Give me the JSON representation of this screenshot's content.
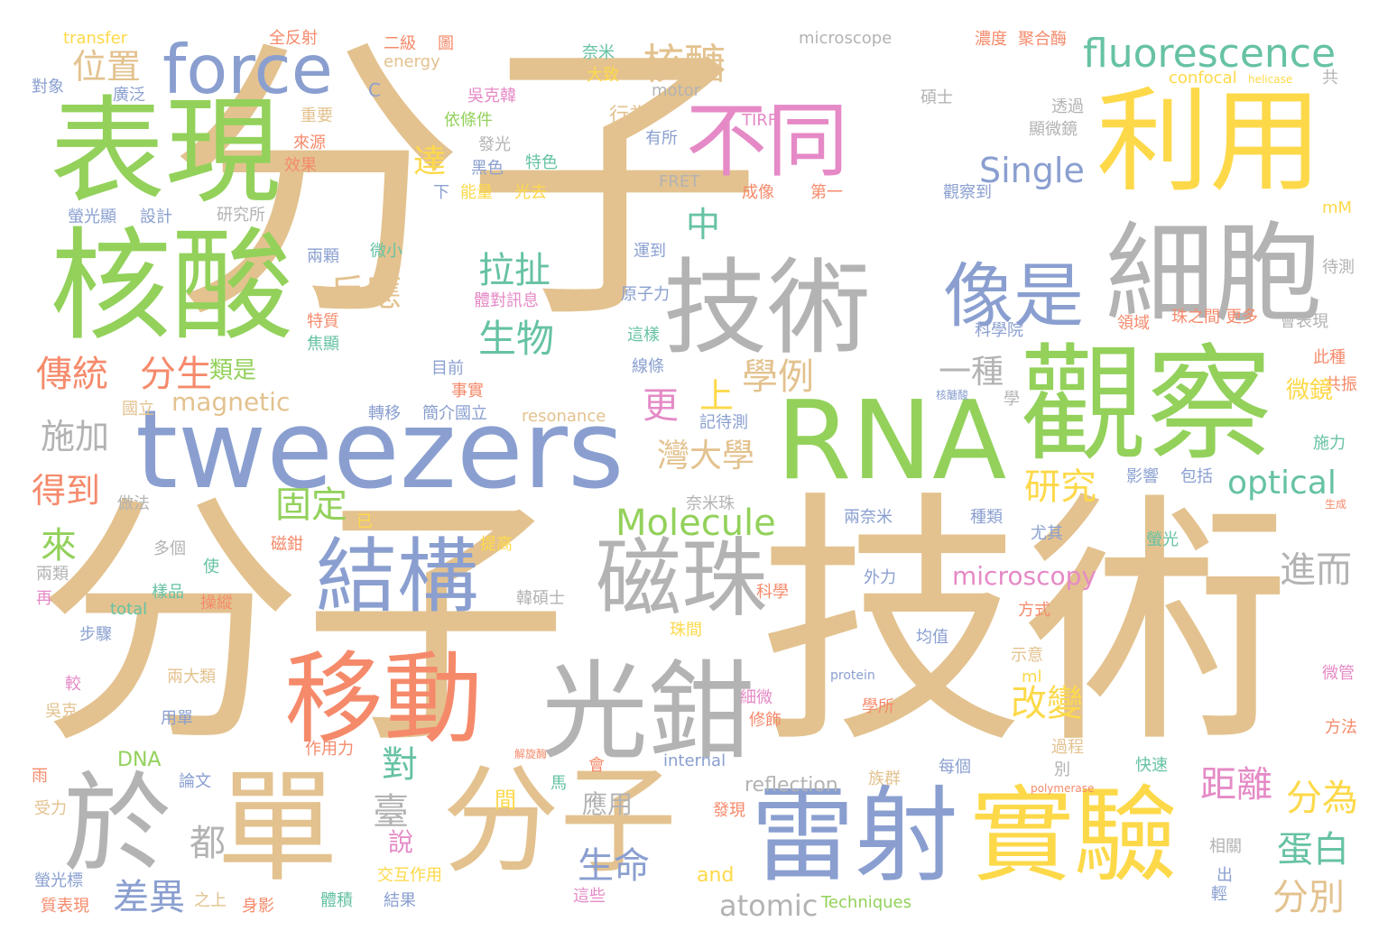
{
  "palette": {
    "tan": "#e3c28f",
    "green": "#93d15b",
    "blue": "#8a9fd0",
    "gray": "#b3b3b3",
    "yellow": "#fdd94a",
    "pink": "#e58ac6",
    "orange": "#f58a6b",
    "teal": "#66c2a4"
  },
  "words": [
    {
      "text": "分子",
      "color": "tan"
    },
    {
      "text": "分子",
      "color": "tan"
    },
    {
      "text": "技術",
      "color": "tan"
    },
    {
      "text": "tweezers",
      "color": "blue"
    },
    {
      "text": "觀察",
      "color": "green"
    },
    {
      "text": "RNA",
      "color": "green"
    },
    {
      "text": "技術",
      "color": "gray"
    },
    {
      "text": "表現",
      "color": "green"
    },
    {
      "text": "核酸",
      "color": "green"
    },
    {
      "text": "利用",
      "color": "yellow"
    },
    {
      "text": "細胞",
      "color": "gray"
    },
    {
      "text": "force",
      "color": "blue"
    },
    {
      "text": "不同",
      "color": "pink"
    },
    {
      "text": "fluorescence",
      "color": "teal"
    },
    {
      "text": "像是",
      "color": "blue"
    },
    {
      "text": "單",
      "color": "tan"
    },
    {
      "text": "分子",
      "color": "tan"
    },
    {
      "text": "雷射",
      "color": "blue"
    },
    {
      "text": "實驗",
      "color": "yellow"
    },
    {
      "text": "於",
      "color": "gray"
    },
    {
      "text": "光鉗",
      "color": "gray"
    },
    {
      "text": "移動",
      "color": "orange"
    },
    {
      "text": "結構",
      "color": "blue"
    },
    {
      "text": "磁珠",
      "color": "gray"
    },
    {
      "text": "核醣",
      "color": "tan"
    },
    {
      "text": "位置",
      "color": "tan"
    },
    {
      "text": "Single",
      "color": "blue"
    },
    {
      "text": "Molecule",
      "color": "green"
    },
    {
      "text": "optical",
      "color": "teal"
    },
    {
      "text": "拉扯",
      "color": "teal"
    },
    {
      "text": "反應",
      "color": "tan"
    },
    {
      "text": "生物",
      "color": "teal"
    },
    {
      "text": "傳統",
      "color": "orange"
    },
    {
      "text": "分生",
      "color": "orange"
    },
    {
      "text": "施加",
      "color": "gray"
    },
    {
      "text": "得到",
      "color": "orange"
    },
    {
      "text": "固定",
      "color": "green"
    },
    {
      "text": "magnetic",
      "color": "tan"
    },
    {
      "text": "一種",
      "color": "gray"
    },
    {
      "text": "學例",
      "color": "tan"
    },
    {
      "text": "灣大學",
      "color": "tan"
    },
    {
      "text": "研究",
      "color": "yellow"
    },
    {
      "text": "進而",
      "color": "gray"
    },
    {
      "text": "改變",
      "color": "yellow"
    },
    {
      "text": "距離",
      "color": "pink"
    },
    {
      "text": "分為",
      "color": "yellow"
    },
    {
      "text": "蛋白",
      "color": "teal"
    },
    {
      "text": "生命",
      "color": "blue"
    },
    {
      "text": "差異",
      "color": "blue"
    },
    {
      "text": "分別",
      "color": "tan"
    },
    {
      "text": "atomic",
      "color": "gray"
    },
    {
      "text": "microscopy",
      "color": "pink"
    },
    {
      "text": "來",
      "color": "green"
    },
    {
      "text": "都",
      "color": "gray"
    },
    {
      "text": "對",
      "color": "teal"
    },
    {
      "text": "臺",
      "color": "gray"
    },
    {
      "text": "說",
      "color": "pink"
    },
    {
      "text": "中",
      "color": "teal"
    },
    {
      "text": "更",
      "color": "pink"
    },
    {
      "text": "上",
      "color": "yellow"
    },
    {
      "text": "達",
      "color": "yellow"
    },
    {
      "text": "應用",
      "color": "gray"
    },
    {
      "text": "microscope",
      "color": "gray"
    },
    {
      "text": "transfer",
      "color": "yellow"
    },
    {
      "text": "全反射",
      "color": "orange"
    },
    {
      "text": "二級",
      "color": "orange"
    },
    {
      "text": "圖",
      "color": "orange"
    },
    {
      "text": "energy",
      "color": "tan"
    },
    {
      "text": "奈米",
      "color": "teal"
    },
    {
      "text": "大致",
      "color": "yellow"
    },
    {
      "text": "濃度",
      "color": "orange"
    },
    {
      "text": "聚合酶",
      "color": "orange"
    },
    {
      "text": "confocal",
      "color": "yellow"
    },
    {
      "text": "helicase",
      "color": "yellow"
    },
    {
      "text": "共",
      "color": "gray"
    },
    {
      "text": "對象",
      "color": "blue"
    },
    {
      "text": "廣泛",
      "color": "blue"
    },
    {
      "text": "C",
      "color": "blue"
    },
    {
      "text": "吳克韓",
      "color": "pink"
    },
    {
      "text": "motor",
      "color": "gray"
    },
    {
      "text": "碩士",
      "color": "gray"
    },
    {
      "text": "透過",
      "color": "gray"
    },
    {
      "text": "重要",
      "color": "tan"
    },
    {
      "text": "行為",
      "color": "tan"
    },
    {
      "text": "依條件",
      "color": "green"
    },
    {
      "text": "TIRF",
      "color": "pink"
    },
    {
      "text": "顯微鏡",
      "color": "gray"
    },
    {
      "text": "來源",
      "color": "orange"
    },
    {
      "text": "有所",
      "color": "blue"
    },
    {
      "text": "發光",
      "color": "gray"
    },
    {
      "text": "效果",
      "color": "orange"
    },
    {
      "text": "黑色",
      "color": "blue"
    },
    {
      "text": "特色",
      "color": "teal"
    },
    {
      "text": "FRET",
      "color": "gray"
    },
    {
      "text": "能量",
      "color": "yellow"
    },
    {
      "text": "光去",
      "color": "yellow"
    },
    {
      "text": "下",
      "color": "blue"
    },
    {
      "text": "成像",
      "color": "orange"
    },
    {
      "text": "第一",
      "color": "orange"
    },
    {
      "text": "觀察到",
      "color": "blue"
    },
    {
      "text": "螢光顯",
      "color": "blue"
    },
    {
      "text": "設計",
      "color": "blue"
    },
    {
      "text": "研究所",
      "color": "gray"
    },
    {
      "text": "mM",
      "color": "yellow"
    },
    {
      "text": "運到",
      "color": "blue"
    },
    {
      "text": "待測",
      "color": "gray"
    },
    {
      "text": "兩顆",
      "color": "blue"
    },
    {
      "text": "微小",
      "color": "teal"
    },
    {
      "text": "原子力",
      "color": "blue"
    },
    {
      "text": "體對訊息",
      "color": "pink"
    },
    {
      "text": "特質",
      "color": "orange"
    },
    {
      "text": "領域",
      "color": "orange"
    },
    {
      "text": "珠之間",
      "color": "orange"
    },
    {
      "text": "更多",
      "color": "orange"
    },
    {
      "text": "會表現",
      "color": "gray"
    },
    {
      "text": "焦顯",
      "color": "teal"
    },
    {
      "text": "這樣",
      "color": "teal"
    },
    {
      "text": "科學院",
      "color": "blue"
    },
    {
      "text": "類是",
      "color": "green"
    },
    {
      "text": "目前",
      "color": "blue"
    },
    {
      "text": "線條",
      "color": "blue"
    },
    {
      "text": "此種",
      "color": "orange"
    },
    {
      "text": "國立",
      "color": "tan"
    },
    {
      "text": "事實",
      "color": "orange"
    },
    {
      "text": "核醣酸",
      "color": "blue"
    },
    {
      "text": "學",
      "color": "gray"
    },
    {
      "text": "轉移",
      "color": "blue"
    },
    {
      "text": "簡介國立",
      "color": "blue"
    },
    {
      "text": "resonance",
      "color": "tan"
    },
    {
      "text": "記待測",
      "color": "blue"
    },
    {
      "text": "共振",
      "color": "orange"
    },
    {
      "text": "微鏡",
      "color": "yellow"
    },
    {
      "text": "施力",
      "color": "teal"
    },
    {
      "text": "影響",
      "color": "blue"
    },
    {
      "text": "包括",
      "color": "blue"
    },
    {
      "text": "做法",
      "color": "gray"
    },
    {
      "text": "已",
      "color": "yellow"
    },
    {
      "text": "奈米珠",
      "color": "gray"
    },
    {
      "text": "兩奈米",
      "color": "blue"
    },
    {
      "text": "種類",
      "color": "blue"
    },
    {
      "text": "生成",
      "color": "orange"
    },
    {
      "text": "多個",
      "color": "gray"
    },
    {
      "text": "磁鉗",
      "color": "orange"
    },
    {
      "text": "提高",
      "color": "yellow"
    },
    {
      "text": "尤其",
      "color": "blue"
    },
    {
      "text": "螢光",
      "color": "teal"
    },
    {
      "text": "兩類",
      "color": "gray"
    },
    {
      "text": "使",
      "color": "teal"
    },
    {
      "text": "外力",
      "color": "blue"
    },
    {
      "text": "樣品",
      "color": "teal"
    },
    {
      "text": "再",
      "color": "pink"
    },
    {
      "text": "操縱",
      "color": "orange"
    },
    {
      "text": "韓碩士",
      "color": "gray"
    },
    {
      "text": "科學",
      "color": "orange"
    },
    {
      "text": "total",
      "color": "teal"
    },
    {
      "text": "方式",
      "color": "orange"
    },
    {
      "text": "珠間",
      "color": "yellow"
    },
    {
      "text": "均值",
      "color": "blue"
    },
    {
      "text": "步驟",
      "color": "blue"
    },
    {
      "text": "示意",
      "color": "tan"
    },
    {
      "text": "兩大類",
      "color": "tan"
    },
    {
      "text": "protein",
      "color": "blue"
    },
    {
      "text": "ml",
      "color": "yellow"
    },
    {
      "text": "微管",
      "color": "pink"
    },
    {
      "text": "較",
      "color": "pink"
    },
    {
      "text": "細微",
      "color": "pink"
    },
    {
      "text": "學所",
      "color": "orange"
    },
    {
      "text": "吳克",
      "color": "tan"
    },
    {
      "text": "用單",
      "color": "blue"
    },
    {
      "text": "修飾",
      "color": "orange"
    },
    {
      "text": "方法",
      "color": "orange"
    },
    {
      "text": "DNA",
      "color": "green"
    },
    {
      "text": "作用力",
      "color": "orange"
    },
    {
      "text": "internal",
      "color": "blue"
    },
    {
      "text": "過程",
      "color": "tan"
    },
    {
      "text": "解旋酶",
      "color": "orange"
    },
    {
      "text": "雨",
      "color": "orange"
    },
    {
      "text": "論文",
      "color": "blue"
    },
    {
      "text": "會",
      "color": "orange"
    },
    {
      "text": "馬",
      "color": "teal"
    },
    {
      "text": "每個",
      "color": "blue"
    },
    {
      "text": "快速",
      "color": "teal"
    },
    {
      "text": "reflection",
      "color": "gray"
    },
    {
      "text": "族群",
      "color": "tan"
    },
    {
      "text": "別",
      "color": "gray"
    },
    {
      "text": "受力",
      "color": "tan"
    },
    {
      "text": "polymerase",
      "color": "orange"
    },
    {
      "text": "發現",
      "color": "orange"
    },
    {
      "text": "相關",
      "color": "gray"
    },
    {
      "text": "交互作用",
      "color": "yellow"
    },
    {
      "text": "and",
      "color": "yellow"
    },
    {
      "text": "出",
      "color": "blue"
    },
    {
      "text": "螢光標",
      "color": "blue"
    },
    {
      "text": "這些",
      "color": "pink"
    },
    {
      "text": "輕",
      "color": "blue"
    },
    {
      "text": "質表現",
      "color": "orange"
    },
    {
      "text": "之上",
      "color": "tan"
    },
    {
      "text": "身影",
      "color": "orange"
    },
    {
      "text": "體積",
      "color": "teal"
    },
    {
      "text": "結果",
      "color": "blue"
    },
    {
      "text": "Techniques",
      "color": "green"
    },
    {
      "text": "間",
      "color": "yellow"
    }
  ]
}
